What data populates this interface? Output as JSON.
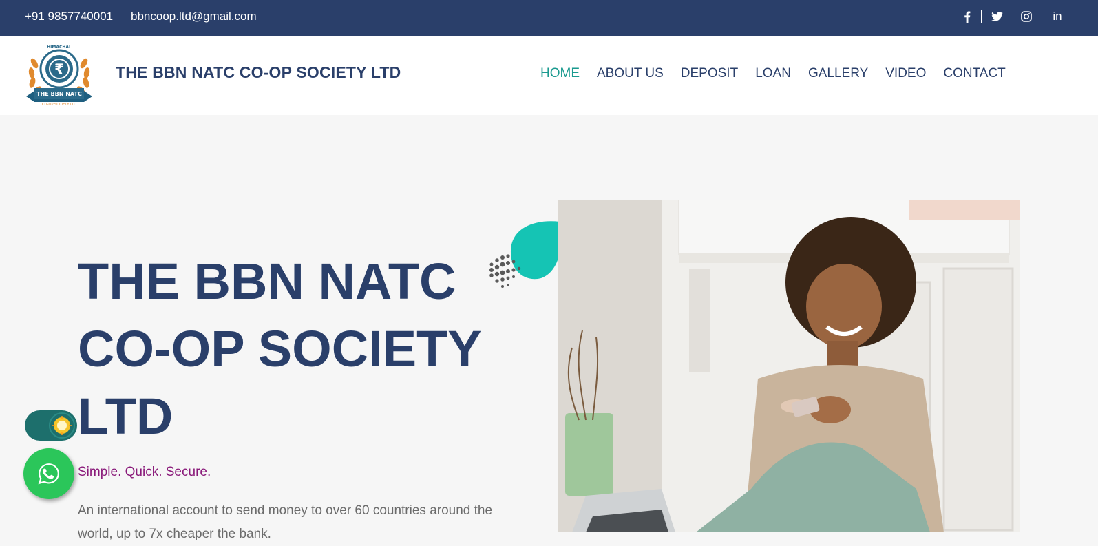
{
  "topbar": {
    "phone": "+91 9857740001",
    "email": "bbncoop.ltd@gmail.com",
    "social": [
      {
        "icon": "facebook-icon",
        "label": "f"
      },
      {
        "icon": "twitter-icon",
        "label": "twitter"
      },
      {
        "icon": "instagram-icon",
        "label": "instagram"
      },
      {
        "icon": "linkedin-icon",
        "label": "in"
      }
    ]
  },
  "header": {
    "brand": "THE BBN NATC CO-OP SOCIETY LTD",
    "logo": {
      "top_text": "HIMACHAL",
      "ribbon_text": "THE BBN NATC",
      "sub_text": "CO-OP SOCIETY LTD"
    },
    "nav": [
      {
        "label": "HOME",
        "active": true
      },
      {
        "label": "ABOUT US",
        "active": false
      },
      {
        "label": "DEPOSIT",
        "active": false
      },
      {
        "label": "LOAN",
        "active": false
      },
      {
        "label": "GALLERY",
        "active": false
      },
      {
        "label": "VIDEO",
        "active": false
      },
      {
        "label": "CONTACT",
        "active": false
      }
    ]
  },
  "hero": {
    "title_lines": [
      "THE BBN NATC",
      "CO-OP SOCIETY",
      "LTD"
    ],
    "tagline": "Simple. Quick. Secure.",
    "description": "An international account to send money to over 60 countries around the world, up to 7x cheaper the bank."
  },
  "colors": {
    "primary": "#2a3f6a",
    "accent": "#1a9a8f",
    "tagline": "#8a1a7a",
    "whatsapp": "#2bc65a",
    "blob": "#15c4b4"
  },
  "widgets": {
    "theme_toggle_icon": "sun-icon",
    "chat_button_icon": "whatsapp-icon"
  }
}
